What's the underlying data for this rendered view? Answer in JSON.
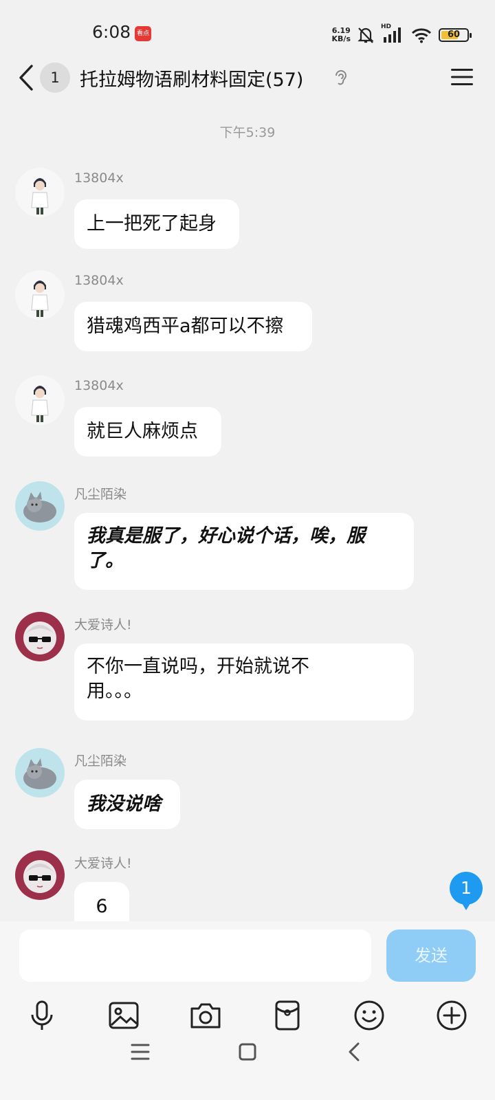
{
  "status_bar": {
    "time": "6:08",
    "app_notification_text": "看点",
    "net_speed_value": "6.19",
    "net_speed_unit": "KB/s",
    "hd_label": "HD",
    "battery_percent": "60",
    "icons": [
      "app-notification-icon",
      "mute-bell-icon",
      "signal-icon",
      "wifi-icon",
      "battery-icon"
    ]
  },
  "header": {
    "back_icon": "chevron-left-icon",
    "unread_count": "1",
    "title": "托拉姆物语刷材料固定(57)",
    "ear_icon": "ear-icon",
    "menu_icon": "hamburger-menu-icon"
  },
  "time_divider": "下午5:39",
  "messages": [
    {
      "sender": "13804x",
      "text": "上一把死了起身",
      "avatar": "doctor-avatar"
    },
    {
      "sender": "13804x",
      "text": "猎魂鸡西平a都可以不擦",
      "avatar": "doctor-avatar"
    },
    {
      "sender": "13804x",
      "text": "就巨人麻烦点",
      "avatar": "doctor-avatar"
    },
    {
      "sender": "凡尘陌染",
      "text": "我真是服了，好心说个话，唉，服了。",
      "avatar": "cat-avatar"
    },
    {
      "sender": "大爱诗人!",
      "text": "不你一直说吗，开始就说不用。。。",
      "avatar": "anime-girl-avatar"
    },
    {
      "sender": "凡尘陌染",
      "text": "我没说啥",
      "avatar": "cat-avatar"
    },
    {
      "sender": "大爱诗人!",
      "text": "6",
      "avatar": "anime-girl-avatar"
    }
  ],
  "new_message_badge": "1",
  "input": {
    "placeholder": "",
    "value": "",
    "send_label": "发送"
  },
  "toolbar": [
    "microphone-icon",
    "image-icon",
    "camera-icon",
    "red-packet-icon",
    "emoji-icon",
    "plus-icon"
  ],
  "nav_bar": [
    "recent-apps-icon",
    "home-icon",
    "back-icon"
  ]
}
